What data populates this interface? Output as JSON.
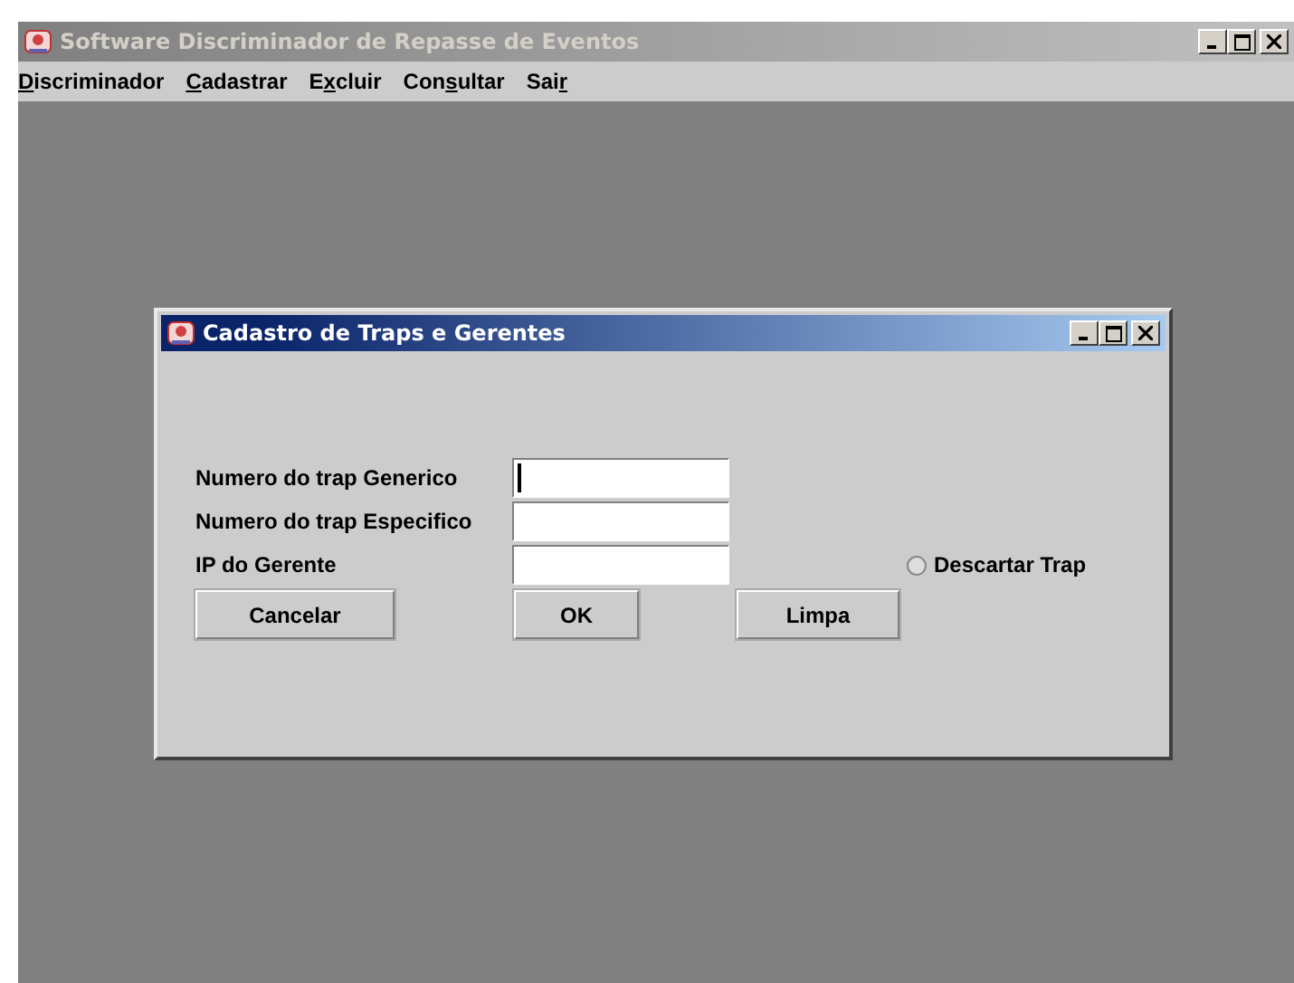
{
  "window": {
    "title": "Software Discriminador de Repasse de Eventos",
    "active": false
  },
  "menu": [
    {
      "parts": [
        {
          "text": "D",
          "underlined": true
        },
        {
          "text": "iscriminador",
          "underlined": false
        }
      ]
    },
    {
      "parts": [
        {
          "text": "C",
          "underlined": true
        },
        {
          "text": "adastrar",
          "underlined": false
        }
      ]
    },
    {
      "parts": [
        {
          "text": "E",
          "underlined": false
        },
        {
          "text": "x",
          "underlined": true
        },
        {
          "text": "cluir",
          "underlined": false
        }
      ]
    },
    {
      "parts": [
        {
          "text": "Con",
          "underlined": false
        },
        {
          "text": "s",
          "underlined": true
        },
        {
          "text": "ultar",
          "underlined": false
        }
      ]
    },
    {
      "parts": [
        {
          "text": "Sai",
          "underlined": false
        },
        {
          "text": "r",
          "underlined": true
        }
      ]
    }
  ],
  "dialog": {
    "title": "Cadastro de Traps e Gerentes",
    "active": true,
    "fields": [
      {
        "label": "Numero do trap Generico",
        "focused": true
      },
      {
        "label": "Numero do trap Especifico",
        "focused": false
      },
      {
        "label": "IP do Gerente",
        "focused": false
      }
    ],
    "radio": {
      "label": "Descartar Trap",
      "selected": false
    },
    "buttons": [
      "Cancelar",
      "OK",
      "Limpa"
    ]
  }
}
